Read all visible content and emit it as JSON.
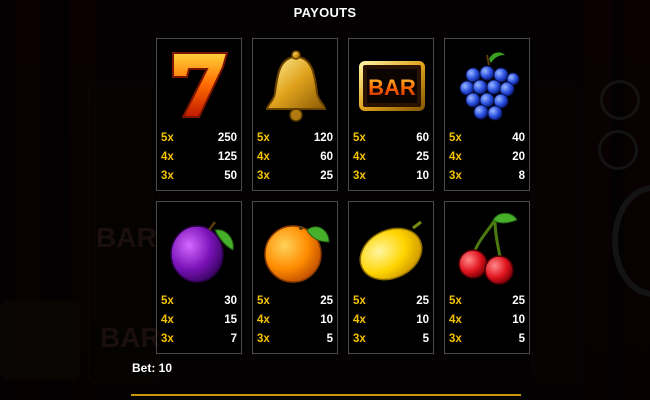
{
  "title": "PAYOUTS",
  "bet_label": "Bet: 10",
  "colors": {
    "multiplier": "#f5c300",
    "payout": "#ffffff",
    "accent_line": "#c9960c"
  },
  "symbols": [
    {
      "name": "seven-icon",
      "rows": [
        {
          "mult": "5x",
          "pay": "250"
        },
        {
          "mult": "4x",
          "pay": "125"
        },
        {
          "mult": "3x",
          "pay": "50"
        }
      ]
    },
    {
      "name": "bell-icon",
      "rows": [
        {
          "mult": "5x",
          "pay": "120"
        },
        {
          "mult": "4x",
          "pay": "60"
        },
        {
          "mult": "3x",
          "pay": "25"
        }
      ]
    },
    {
      "name": "bar-icon",
      "text": "BAR",
      "rows": [
        {
          "mult": "5x",
          "pay": "60"
        },
        {
          "mult": "4x",
          "pay": "25"
        },
        {
          "mult": "3x",
          "pay": "10"
        }
      ]
    },
    {
      "name": "grapes-icon",
      "rows": [
        {
          "mult": "5x",
          "pay": "40"
        },
        {
          "mult": "4x",
          "pay": "20"
        },
        {
          "mult": "3x",
          "pay": "8"
        }
      ]
    },
    {
      "name": "plum-icon",
      "rows": [
        {
          "mult": "5x",
          "pay": "30"
        },
        {
          "mult": "4x",
          "pay": "15"
        },
        {
          "mult": "3x",
          "pay": "7"
        }
      ]
    },
    {
      "name": "orange-icon",
      "rows": [
        {
          "mult": "5x",
          "pay": "25"
        },
        {
          "mult": "4x",
          "pay": "10"
        },
        {
          "mult": "3x",
          "pay": "5"
        }
      ]
    },
    {
      "name": "lemon-icon",
      "rows": [
        {
          "mult": "5x",
          "pay": "25"
        },
        {
          "mult": "4x",
          "pay": "10"
        },
        {
          "mult": "3x",
          "pay": "5"
        }
      ]
    },
    {
      "name": "cherries-icon",
      "rows": [
        {
          "mult": "5x",
          "pay": "25"
        },
        {
          "mult": "4x",
          "pay": "10"
        },
        {
          "mult": "3x",
          "pay": "5"
        }
      ]
    }
  ]
}
